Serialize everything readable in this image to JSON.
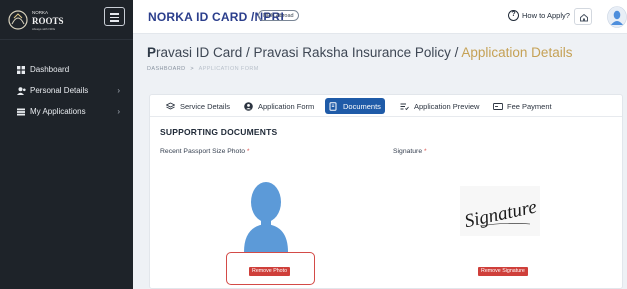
{
  "sidebar": {
    "logo_alt": "NORKA ROOTS",
    "items": [
      {
        "label": "Dashboard",
        "icon": "dashboard-icon",
        "has_chevron": false
      },
      {
        "label": "Personal Details",
        "icon": "user-icon",
        "has_chevron": true
      },
      {
        "label": "My Applications",
        "icon": "list-icon",
        "has_chevron": true
      }
    ]
  },
  "header": {
    "brand": "NORKA ID CARD /NPRI",
    "badge": "NRK Abroad",
    "how_to_label": "How to Apply?",
    "how_to_icon": "question-icon",
    "home_icon": "home-icon",
    "avatar_icon": "avatar-icon"
  },
  "page": {
    "title_first_letter": "P",
    "title_rest": "ravasi ID Card / Pravasi Raksha Insurance Policy / ",
    "title_accent": "Application Details",
    "breadcrumb": [
      "DASHBOARD",
      ">",
      "APPLICATION FORM"
    ]
  },
  "tabs": [
    {
      "label": "Service Details",
      "icon": "layers-icon",
      "active": false
    },
    {
      "label": "Application Form",
      "icon": "user-circle-icon",
      "active": false
    },
    {
      "label": "Documents",
      "icon": "document-icon",
      "active": true
    },
    {
      "label": "Application Preview",
      "icon": "list-check-icon",
      "active": false
    },
    {
      "label": "Fee Payment",
      "icon": "card-icon",
      "active": false
    }
  ],
  "documents": {
    "section_title": "SUPPORTING DOCUMENTS",
    "photo_label": "Recent Passport Size Photo",
    "signature_label": "Signature",
    "required_mark": "*",
    "remove_photo": "Remove Photo",
    "remove_signature": "Remove Signature",
    "signature_image_text": "Signature"
  },
  "colors": {
    "sidebar_bg": "#1e2329",
    "brand": "#2b3e8c",
    "accent": "#c5a155",
    "active_tab": "#1f5ba8",
    "danger": "#cf3f3a",
    "photo_silhouette": "#5c9ad8"
  }
}
